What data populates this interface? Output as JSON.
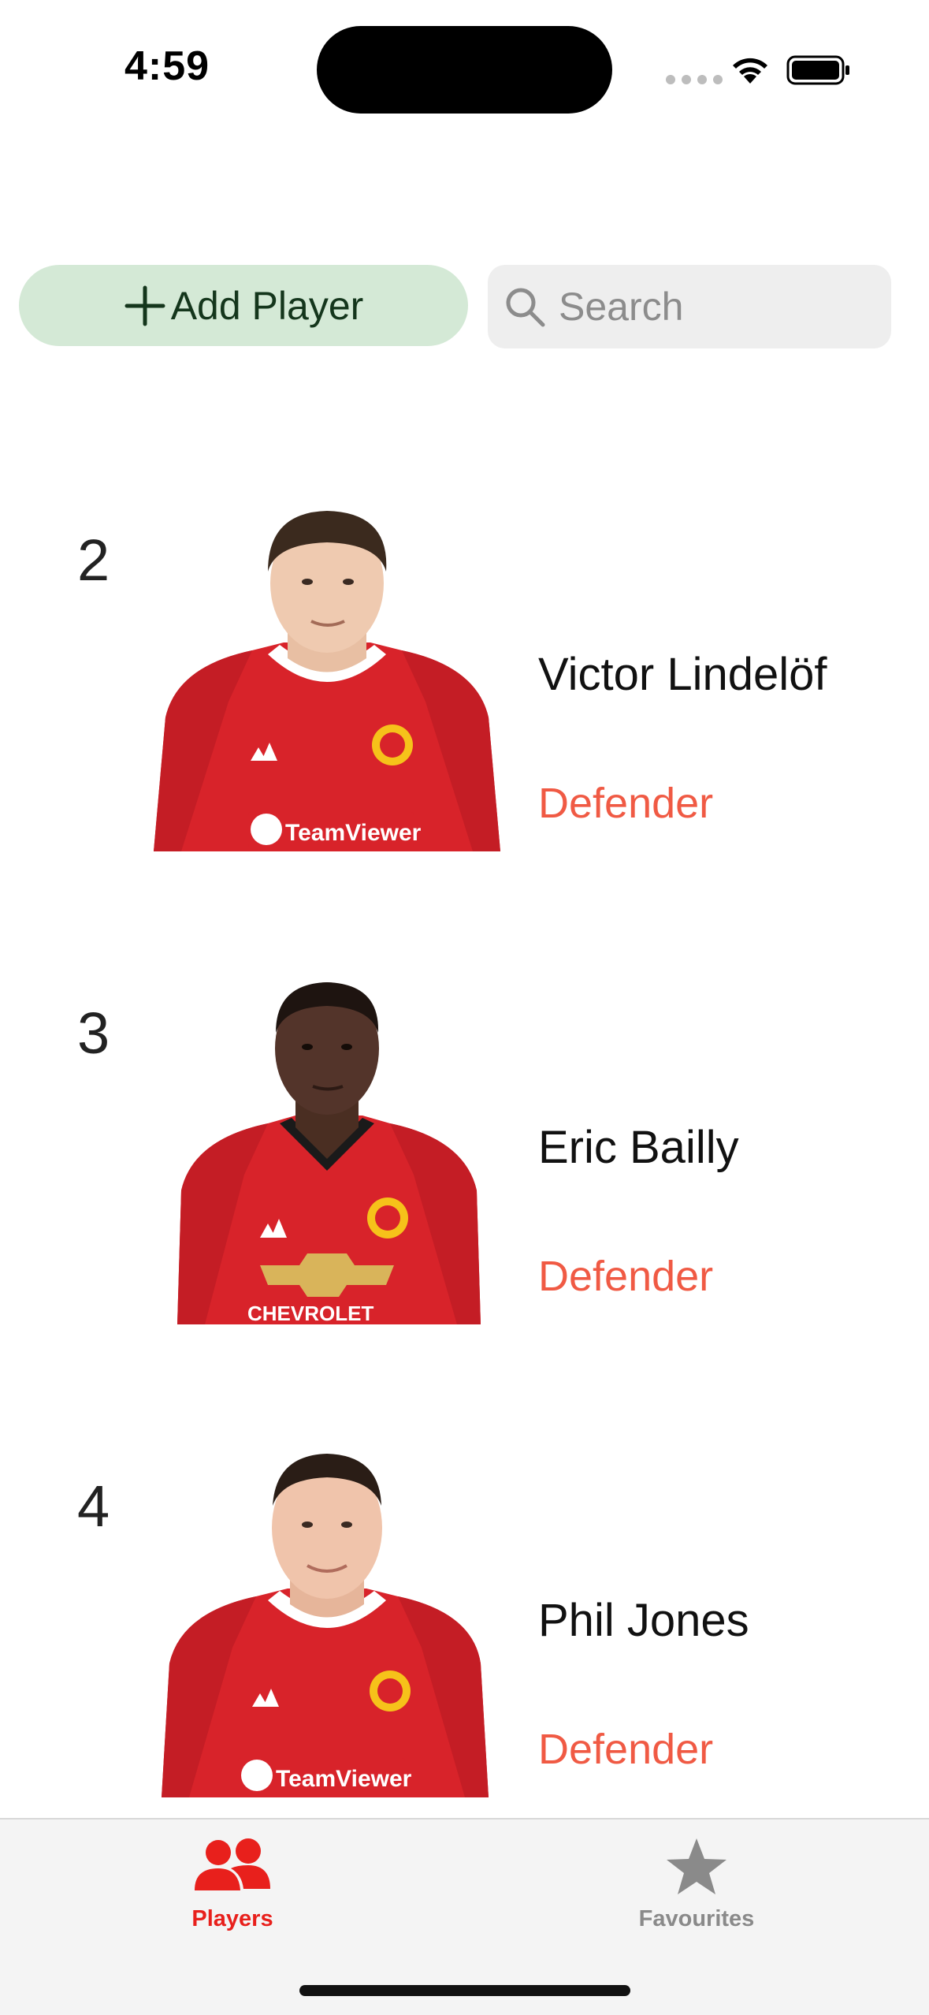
{
  "status_bar": {
    "time": "4:59"
  },
  "toolbar": {
    "add_player_label": "Add Player",
    "search_placeholder": "Search",
    "search_value": ""
  },
  "players": [
    {
      "number": "2",
      "name": "Victor Lindelöf",
      "position": "Defender",
      "sponsor": "TeamViewer"
    },
    {
      "number": "3",
      "name": "Eric Bailly",
      "position": "Defender",
      "sponsor": "CHEVROLET"
    },
    {
      "number": "4",
      "name": "Phil Jones",
      "position": "Defender",
      "sponsor": "TeamViewer"
    }
  ],
  "tab_bar": {
    "players_label": "Players",
    "favourites_label": "Favourites",
    "active_tab": "Players"
  },
  "colors": {
    "accent_red": "#e8201c",
    "position_text": "#f05a44",
    "add_button_bg": "#d4e9d6",
    "search_bg": "#eeeeee",
    "shirt_red": "#d8232a",
    "inactive_tab": "#8a8a8a"
  },
  "icons": {
    "add": "plus-icon",
    "search": "magnifier-icon",
    "players_tab": "people-icon",
    "favourites_tab": "star-icon"
  }
}
